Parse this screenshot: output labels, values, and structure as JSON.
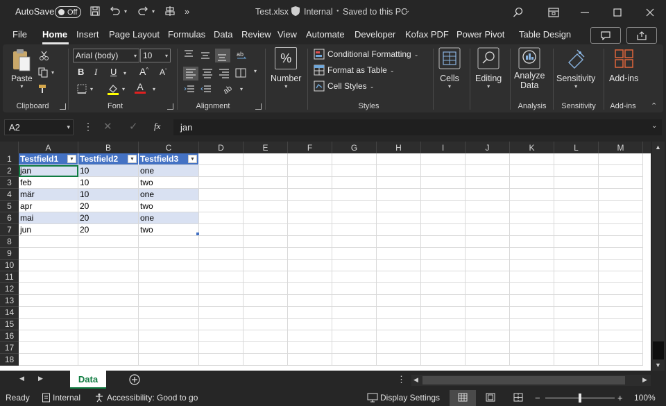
{
  "titlebar": {
    "autosave_label": "AutoSave",
    "autosave_state": "Off",
    "filename": "Test.xlsx",
    "sensitivity": "Internal",
    "save_status": "Saved to this PC"
  },
  "tabs": [
    "File",
    "Home",
    "Insert",
    "Page Layout",
    "Formulas",
    "Data",
    "Review",
    "View",
    "Automate",
    "Developer",
    "Kofax PDF",
    "Power Pivot",
    "Table Design"
  ],
  "active_tab": "Home",
  "ribbon": {
    "clipboard": {
      "paste": "Paste",
      "label": "Clipboard"
    },
    "font": {
      "name": "Arial (body)",
      "size": "10",
      "bold": "B",
      "italic": "I",
      "underline": "U",
      "grow": "A",
      "shrink": "A",
      "label": "Font"
    },
    "alignment": {
      "label": "Alignment"
    },
    "number": {
      "symbol": "%",
      "title": "Number"
    },
    "styles": {
      "conditional": "Conditional Formatting",
      "format_table": "Format as Table",
      "cell_styles": "Cell Styles",
      "label": "Styles"
    },
    "cells": {
      "title": "Cells"
    },
    "editing": {
      "title": "Editing"
    },
    "analysis": {
      "title1": "Analyze",
      "title2": "Data",
      "label": "Analysis"
    },
    "sensitivity": {
      "title": "Sensitivity",
      "label": "Sensitivity"
    },
    "addins": {
      "title": "Add-ins",
      "label": "Add-ins"
    }
  },
  "formula_bar": {
    "name_box": "A2",
    "fx": "fx",
    "value": "jan"
  },
  "columns": [
    "A",
    "B",
    "C",
    "D",
    "E",
    "F",
    "G",
    "H",
    "I",
    "J",
    "K",
    "L",
    "M"
  ],
  "rows": [
    "1",
    "2",
    "3",
    "4",
    "5",
    "6",
    "7",
    "8",
    "9",
    "10",
    "11",
    "12",
    "13",
    "14",
    "15",
    "16",
    "17",
    "18"
  ],
  "table": {
    "headers": [
      "Testfield1",
      "Testfield2",
      "Testfield3"
    ],
    "data": [
      [
        "jan",
        "10",
        "one"
      ],
      [
        "feb",
        "10",
        "two"
      ],
      [
        "mär",
        "10",
        "one"
      ],
      [
        "apr",
        "20",
        "two"
      ],
      [
        "mai",
        "20",
        "one"
      ],
      [
        "jun",
        "20",
        "two"
      ]
    ]
  },
  "sheets": [
    "Data"
  ],
  "status": {
    "ready": "Ready",
    "sensitivity": "Internal",
    "accessibility": "Accessibility: Good to go",
    "display_settings": "Display Settings",
    "zoom_minus": "−",
    "zoom_plus": "+",
    "zoom": "100%"
  },
  "colors": {
    "table_header": "#4472c4",
    "band": "#d9e1f2",
    "accent": "#107c41"
  }
}
